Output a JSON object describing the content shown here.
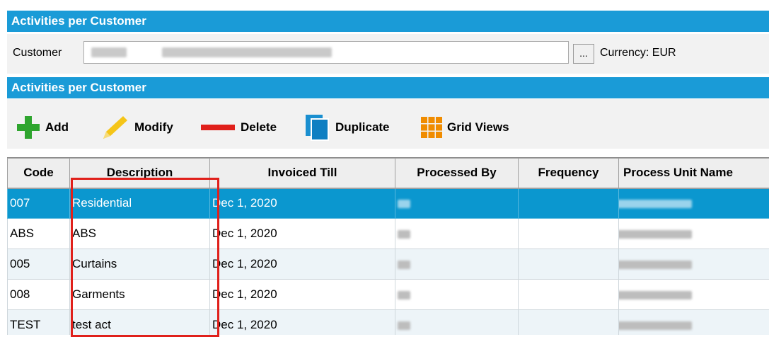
{
  "header_top": {
    "title": "Activities per Customer"
  },
  "customer": {
    "label": "Customer",
    "ellipsis": "...",
    "currency_label": "Currency: EUR"
  },
  "header_section": {
    "title": "Activities per Customer"
  },
  "toolbar": {
    "add": "Add",
    "modify": "Modify",
    "delete": "Delete",
    "duplicate": "Duplicate",
    "grid_views": "Grid Views"
  },
  "grid": {
    "columns": [
      "Code",
      "Description",
      "Invoiced Till",
      "Processed By",
      "Frequency",
      "Process Unit Name"
    ],
    "rows": [
      {
        "code": "007",
        "description": "Residential",
        "invoiced_till": "Dec 1, 2020",
        "selected": true
      },
      {
        "code": "ABS",
        "description": "ABS",
        "invoiced_till": "Dec 1, 2020",
        "selected": false
      },
      {
        "code": "005",
        "description": "Curtains",
        "invoiced_till": "Dec 1, 2020",
        "selected": false
      },
      {
        "code": "008",
        "description": "Garments",
        "invoiced_till": "Dec 1, 2020",
        "selected": false
      },
      {
        "code": "TEST",
        "description": "test act",
        "invoiced_till": "Dec 1, 2020",
        "selected": false
      }
    ]
  },
  "colors": {
    "header_bg": "#1a9bd7",
    "selected_row": "#0b97cf",
    "add_icon": "#2fa52f",
    "modify_icon": "#f5c518",
    "delete_icon": "#e0201b",
    "duplicate_icon": "#1a8fd0",
    "gridviews_icon": "#f08c00",
    "annotation_box": "#e0201b"
  },
  "icons": [
    "add-icon",
    "pencil-icon",
    "delete-icon",
    "duplicate-icon",
    "grid-views-icon"
  ]
}
